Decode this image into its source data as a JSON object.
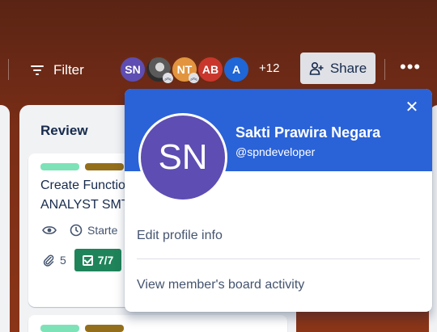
{
  "header": {
    "filter_label": "Filter",
    "members": [
      {
        "initials": "SN",
        "color": "#5e4db2",
        "admin": false
      },
      {
        "initials": "",
        "color": "#5a5a5a",
        "admin": true
      },
      {
        "initials": "NT",
        "color": "#e2953e",
        "admin": true
      },
      {
        "initials": "AB",
        "color": "#c9372c",
        "admin": false
      },
      {
        "initials": "A",
        "color": "#1f66d6",
        "admin": false
      }
    ],
    "more_members": "+12",
    "share_label": "Share"
  },
  "list": {
    "title": "Review",
    "card": {
      "title_line1": "Create Functio",
      "title_line2": "ANALYST SMT",
      "started_label": "Starte",
      "attachments": "5",
      "checklist": "7/7"
    }
  },
  "popover": {
    "initials": "SN",
    "name": "Sakti Prawira Negara",
    "handle": "@spndeveloper",
    "edit_profile": "Edit profile info",
    "view_activity": "View member's board activity"
  },
  "colors": {
    "accent": "#2a62d8",
    "checklist_complete": "#1f845a",
    "label_green": "#7ee2b8",
    "label_olive": "#946f1b"
  }
}
